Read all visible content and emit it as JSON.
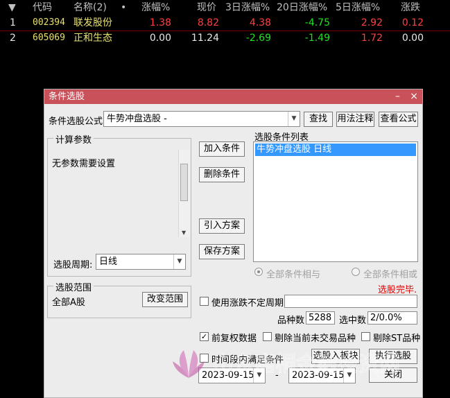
{
  "grid": {
    "sort_arrow": "▼",
    "headers": [
      "代码",
      "名称(2)",
      "•",
      "涨幅%",
      "现价",
      "3日涨幅%",
      "20日涨幅%",
      "5日涨幅%",
      "涨跌"
    ],
    "rows": [
      {
        "idx": "1",
        "code": "002394",
        "name": "联发股份",
        "chg": "1.38",
        "price": "8.82",
        "d3": "4.38",
        "d20": "-4.75",
        "d5": "2.92",
        "diff": "0.12"
      },
      {
        "idx": "2",
        "code": "605069",
        "name": "正和生态",
        "chg": "0.00",
        "price": "11.24",
        "d3": "-2.69",
        "d20": "-1.49",
        "d5": "1.72",
        "diff": "0.00"
      }
    ],
    "colors": {
      "code": "#e8e070",
      "name": "#e8e070",
      "up": "#ff4040",
      "down": "#20e020",
      "flat": "#e8e8e8",
      "header": "#c0c0c0"
    }
  },
  "dialog": {
    "title": "条件选股",
    "minimize": "–",
    "close": "×",
    "formula_label": "条件选股公式",
    "formula_value": "牛势冲盘选股  -",
    "btn_find": "查找",
    "btn_usage": "用法注释",
    "btn_view": "查看公式",
    "params_title": "计算参数",
    "params_text": "无参数需要设置",
    "period_label": "选股周期:",
    "period_value": "日线",
    "btn_add": "加入条件",
    "btn_delete": "删除条件",
    "btn_import": "引入方案",
    "btn_save": "保存方案",
    "cond_list_title": "选股条件列表",
    "cond_items": [
      "牛势冲盘选股  日线"
    ],
    "radio_and": "全部条件相与",
    "radio_or": "全部条件相或",
    "status": "选股完毕.",
    "range_title": "选股范围",
    "range_value": "全部A股",
    "btn_change_range": "改变范围",
    "chk_uncertain": "使用涨跌不定周期",
    "count_label": "品种数",
    "count_value": "5288",
    "selected_label": "选中数",
    "selected_value": "2/0.0%",
    "chk_adjust": "前复权数据",
    "chk_exclude_suspended": "剔除当前未交易品种",
    "chk_exclude_st": "剔除ST品种",
    "chk_timerange": "时间段内满足条件",
    "btn_to_block": "选股入板块",
    "btn_execute": "执行选股",
    "date_from": "2023-09-15",
    "date_sep": "-",
    "date_to": "2023-09-15",
    "btn_close": "关闭"
  },
  "watermark": {
    "text": "山东嘉桐金融投资网",
    "color": "#d060b0"
  }
}
